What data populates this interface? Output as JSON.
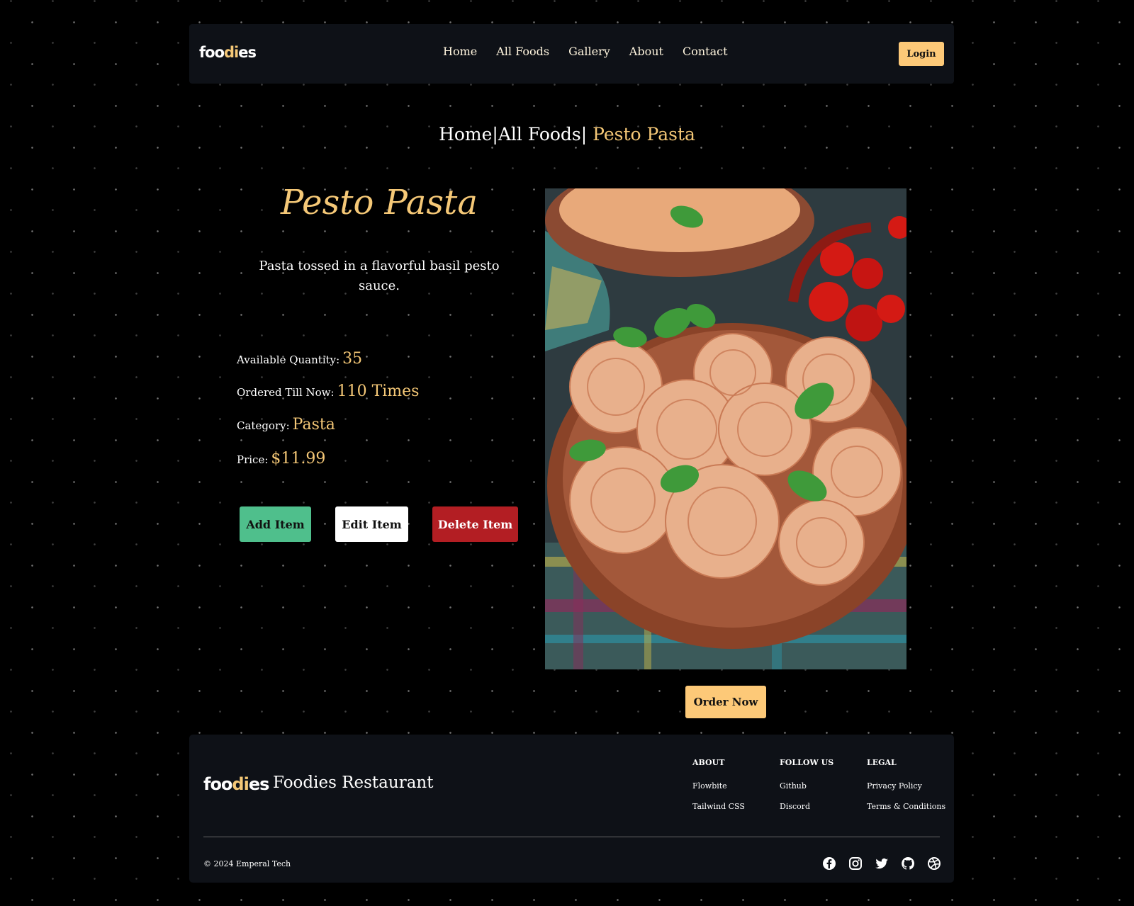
{
  "nav": {
    "logo_text_start": "foo",
    "logo_text_mid": "di",
    "logo_text_end": "es",
    "links": [
      "Home",
      "All Foods",
      "Gallery",
      "About",
      "Contact"
    ],
    "login_label": "Login"
  },
  "breadcrumb": {
    "home": "Home",
    "sep1": "|",
    "all_foods": "All Foods",
    "sep2": "|",
    "current": " Pesto Pasta"
  },
  "item": {
    "title": "Pesto Pasta",
    "description": "Pasta tossed in a flavorful basil pesto sauce.",
    "quantity_label": "Available Quantity:",
    "quantity_value": "35",
    "ordered_label": "Ordered Till Now:",
    "ordered_value": "110 Times",
    "category_label": "Category:",
    "category_value": "Pasta",
    "price_label": "Price:",
    "price_value": "$11.99",
    "image_subject": "food-photo-pasta"
  },
  "actions": {
    "add_label": "Add Item",
    "edit_label": "Edit Item",
    "delete_label": "Delete Item",
    "order_label": "Order Now"
  },
  "footer": {
    "name": "Foodies Restaurant",
    "columns": [
      {
        "heading": "ABOUT",
        "links": [
          "Flowbite",
          "Tailwind CSS"
        ]
      },
      {
        "heading": "FOLLOW US",
        "links": [
          "Github",
          "Discord"
        ]
      },
      {
        "heading": "LEGAL",
        "links": [
          "Privacy Policy",
          "Terms & Conditions"
        ]
      }
    ],
    "copyright": "© 2024 Emperal Tech",
    "social_icons": [
      "facebook-icon",
      "instagram-icon",
      "twitter-icon",
      "github-icon",
      "dribbble-icon"
    ]
  },
  "colors": {
    "accent": "#f5c877",
    "button_yellow": "#fdc978",
    "add_green": "#4fbf8c",
    "delete_red": "#b31e23",
    "panel_bg": "#0e1117"
  }
}
